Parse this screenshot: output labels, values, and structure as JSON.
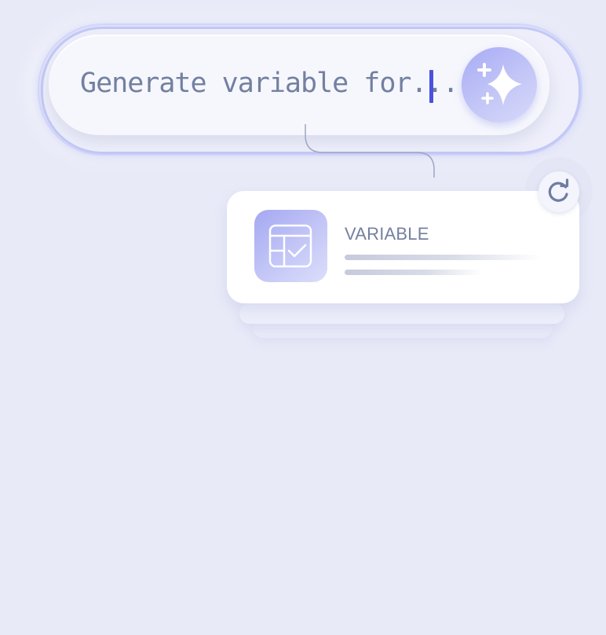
{
  "prompt": {
    "text": "Generate variable for...",
    "sparkle_button_icon": "sparkle-icon"
  },
  "result_card": {
    "title": "VARIABLE",
    "icon": "table-check-icon",
    "refresh_icon": "refresh-icon"
  },
  "colors": {
    "background": "#e8eaf8",
    "accent": "#4b52dd",
    "button_gradient_start": "#a7abf5",
    "text_muted": "#7380a0"
  }
}
